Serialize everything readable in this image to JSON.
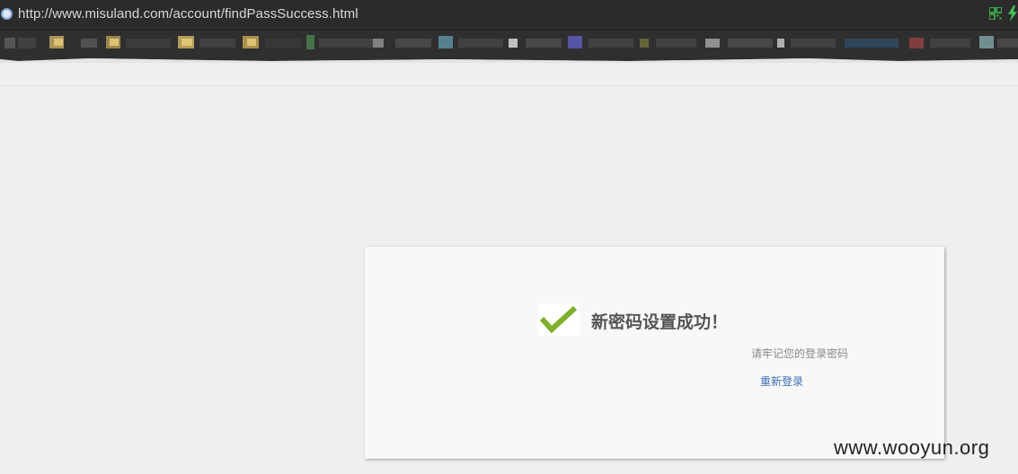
{
  "browser": {
    "url": "http://www.misuland.com/account/findPassSuccess.html",
    "icons": {
      "site": "site-favicon-icon",
      "qr": "qr-code-icon",
      "extension": "lightning-bolt-icon"
    }
  },
  "page": {
    "title": "新密码设置成功！",
    "hint": "请牢记您的登录密码",
    "relogin_link": "重新登录",
    "success_icon": "checkmark-icon",
    "colors": {
      "check": "#7db12a",
      "link": "#3a6fb5",
      "title": "#555555"
    }
  },
  "watermark": "www.wooyun.org"
}
